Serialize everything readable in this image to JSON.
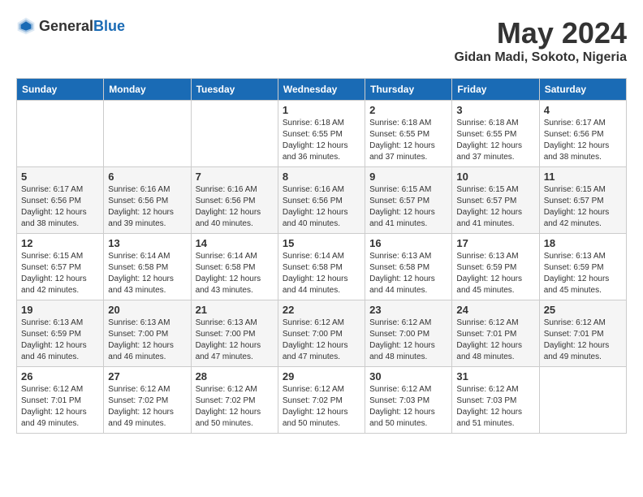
{
  "header": {
    "logo_general": "General",
    "logo_blue": "Blue",
    "title": "May 2024",
    "location": "Gidan Madi, Sokoto, Nigeria"
  },
  "calendar": {
    "weekdays": [
      "Sunday",
      "Monday",
      "Tuesday",
      "Wednesday",
      "Thursday",
      "Friday",
      "Saturday"
    ],
    "weeks": [
      [
        {
          "day": "",
          "info": ""
        },
        {
          "day": "",
          "info": ""
        },
        {
          "day": "",
          "info": ""
        },
        {
          "day": "1",
          "info": "Sunrise: 6:18 AM\nSunset: 6:55 PM\nDaylight: 12 hours\nand 36 minutes."
        },
        {
          "day": "2",
          "info": "Sunrise: 6:18 AM\nSunset: 6:55 PM\nDaylight: 12 hours\nand 37 minutes."
        },
        {
          "day": "3",
          "info": "Sunrise: 6:18 AM\nSunset: 6:55 PM\nDaylight: 12 hours\nand 37 minutes."
        },
        {
          "day": "4",
          "info": "Sunrise: 6:17 AM\nSunset: 6:56 PM\nDaylight: 12 hours\nand 38 minutes."
        }
      ],
      [
        {
          "day": "5",
          "info": "Sunrise: 6:17 AM\nSunset: 6:56 PM\nDaylight: 12 hours\nand 38 minutes."
        },
        {
          "day": "6",
          "info": "Sunrise: 6:16 AM\nSunset: 6:56 PM\nDaylight: 12 hours\nand 39 minutes."
        },
        {
          "day": "7",
          "info": "Sunrise: 6:16 AM\nSunset: 6:56 PM\nDaylight: 12 hours\nand 40 minutes."
        },
        {
          "day": "8",
          "info": "Sunrise: 6:16 AM\nSunset: 6:56 PM\nDaylight: 12 hours\nand 40 minutes."
        },
        {
          "day": "9",
          "info": "Sunrise: 6:15 AM\nSunset: 6:57 PM\nDaylight: 12 hours\nand 41 minutes."
        },
        {
          "day": "10",
          "info": "Sunrise: 6:15 AM\nSunset: 6:57 PM\nDaylight: 12 hours\nand 41 minutes."
        },
        {
          "day": "11",
          "info": "Sunrise: 6:15 AM\nSunset: 6:57 PM\nDaylight: 12 hours\nand 42 minutes."
        }
      ],
      [
        {
          "day": "12",
          "info": "Sunrise: 6:15 AM\nSunset: 6:57 PM\nDaylight: 12 hours\nand 42 minutes."
        },
        {
          "day": "13",
          "info": "Sunrise: 6:14 AM\nSunset: 6:58 PM\nDaylight: 12 hours\nand 43 minutes."
        },
        {
          "day": "14",
          "info": "Sunrise: 6:14 AM\nSunset: 6:58 PM\nDaylight: 12 hours\nand 43 minutes."
        },
        {
          "day": "15",
          "info": "Sunrise: 6:14 AM\nSunset: 6:58 PM\nDaylight: 12 hours\nand 44 minutes."
        },
        {
          "day": "16",
          "info": "Sunrise: 6:13 AM\nSunset: 6:58 PM\nDaylight: 12 hours\nand 44 minutes."
        },
        {
          "day": "17",
          "info": "Sunrise: 6:13 AM\nSunset: 6:59 PM\nDaylight: 12 hours\nand 45 minutes."
        },
        {
          "day": "18",
          "info": "Sunrise: 6:13 AM\nSunset: 6:59 PM\nDaylight: 12 hours\nand 45 minutes."
        }
      ],
      [
        {
          "day": "19",
          "info": "Sunrise: 6:13 AM\nSunset: 6:59 PM\nDaylight: 12 hours\nand 46 minutes."
        },
        {
          "day": "20",
          "info": "Sunrise: 6:13 AM\nSunset: 7:00 PM\nDaylight: 12 hours\nand 46 minutes."
        },
        {
          "day": "21",
          "info": "Sunrise: 6:13 AM\nSunset: 7:00 PM\nDaylight: 12 hours\nand 47 minutes."
        },
        {
          "day": "22",
          "info": "Sunrise: 6:12 AM\nSunset: 7:00 PM\nDaylight: 12 hours\nand 47 minutes."
        },
        {
          "day": "23",
          "info": "Sunrise: 6:12 AM\nSunset: 7:00 PM\nDaylight: 12 hours\nand 48 minutes."
        },
        {
          "day": "24",
          "info": "Sunrise: 6:12 AM\nSunset: 7:01 PM\nDaylight: 12 hours\nand 48 minutes."
        },
        {
          "day": "25",
          "info": "Sunrise: 6:12 AM\nSunset: 7:01 PM\nDaylight: 12 hours\nand 49 minutes."
        }
      ],
      [
        {
          "day": "26",
          "info": "Sunrise: 6:12 AM\nSunset: 7:01 PM\nDaylight: 12 hours\nand 49 minutes."
        },
        {
          "day": "27",
          "info": "Sunrise: 6:12 AM\nSunset: 7:02 PM\nDaylight: 12 hours\nand 49 minutes."
        },
        {
          "day": "28",
          "info": "Sunrise: 6:12 AM\nSunset: 7:02 PM\nDaylight: 12 hours\nand 50 minutes."
        },
        {
          "day": "29",
          "info": "Sunrise: 6:12 AM\nSunset: 7:02 PM\nDaylight: 12 hours\nand 50 minutes."
        },
        {
          "day": "30",
          "info": "Sunrise: 6:12 AM\nSunset: 7:03 PM\nDaylight: 12 hours\nand 50 minutes."
        },
        {
          "day": "31",
          "info": "Sunrise: 6:12 AM\nSunset: 7:03 PM\nDaylight: 12 hours\nand 51 minutes."
        },
        {
          "day": "",
          "info": ""
        }
      ]
    ]
  }
}
